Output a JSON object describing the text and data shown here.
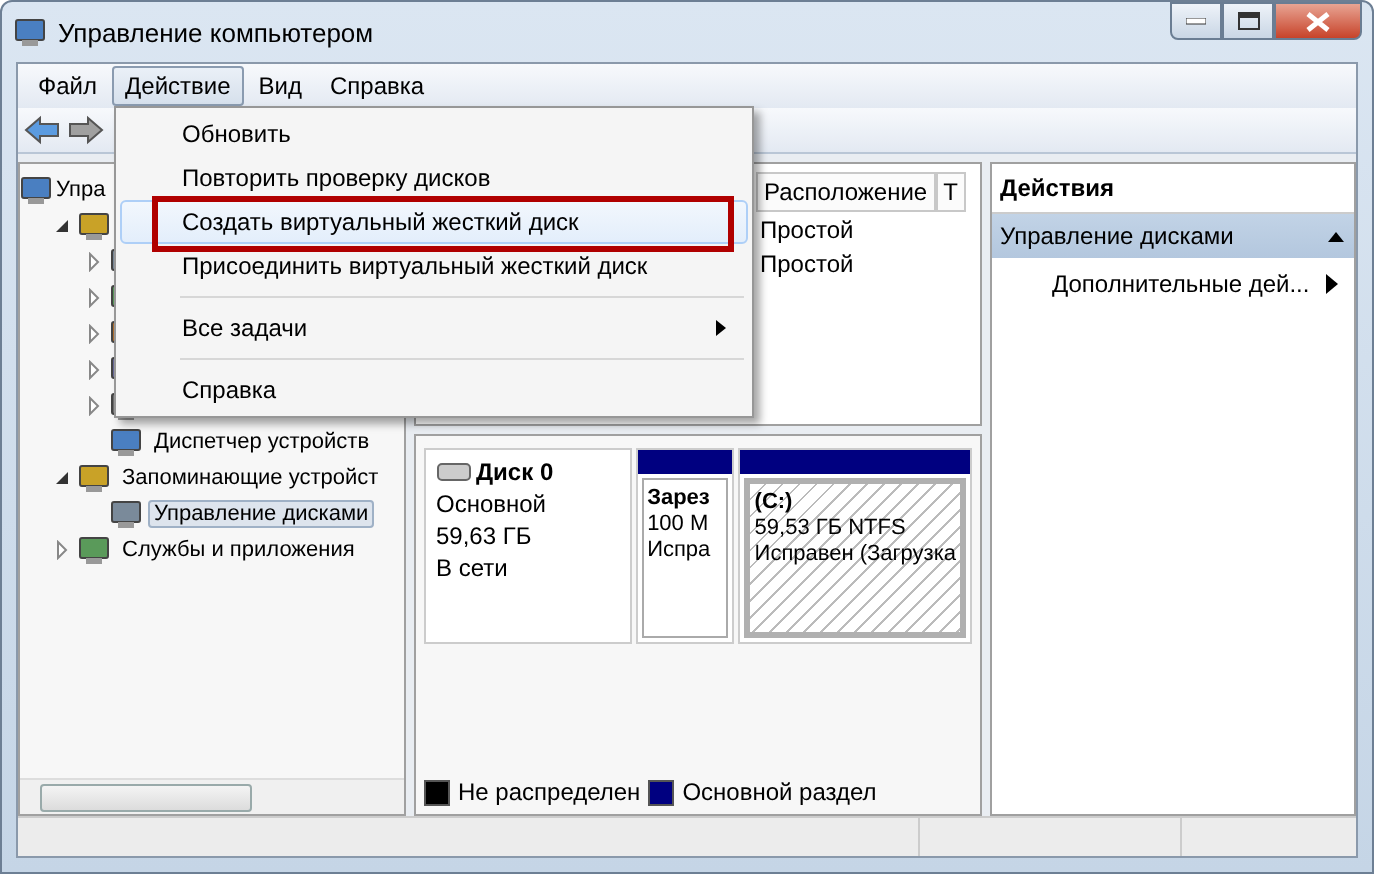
{
  "window": {
    "title": "Управление компьютером"
  },
  "menu_bar": [
    {
      "label": "Файл",
      "selected": false
    },
    {
      "label": "Действие",
      "selected": true
    },
    {
      "label": "Вид",
      "selected": false
    },
    {
      "label": "Справка",
      "selected": false
    }
  ],
  "dropdown": {
    "items": [
      {
        "kind": "item",
        "label": "Обновить",
        "highlighted": false
      },
      {
        "kind": "item",
        "label": "Повторить проверку дисков",
        "highlighted": false
      },
      {
        "kind": "item",
        "label": "Создать виртуальный жесткий диск",
        "highlighted": true
      },
      {
        "kind": "item",
        "label": "Присоединить виртуальный жесткий диск",
        "highlighted": false
      },
      {
        "kind": "separator"
      },
      {
        "kind": "submenu",
        "label": "Все задачи",
        "highlighted": false
      },
      {
        "kind": "separator"
      },
      {
        "kind": "item",
        "label": "Справка",
        "highlighted": false
      }
    ]
  },
  "tree": [
    {
      "label": "Упра",
      "selected": false,
      "children": [
        {
          "expanded": true,
          "selected": false,
          "children": [
            {
              "expanded": false,
              "selected": false
            },
            {
              "expanded": false,
              "selected": false
            },
            {
              "expanded": false,
              "selected": false
            },
            {
              "expanded": false,
              "selected": false
            },
            {
              "expanded": false,
              "selected": false
            },
            {
              "label": "Диспетчер устройств",
              "selected": false
            }
          ]
        },
        {
          "label": "Запоминающие устройст",
          "expanded": true,
          "selected": false,
          "children": [
            {
              "label": "Управление дисками",
              "selected": true
            }
          ]
        },
        {
          "label": "Службы и приложения",
          "expanded": false,
          "selected": false
        }
      ]
    }
  ],
  "volume_list": {
    "columns": [
      "Расположение",
      "Т"
    ],
    "rows": [
      [
        "Простой"
      ],
      [
        "Простой"
      ]
    ]
  },
  "disk": {
    "name": "Диск 0",
    "type": "Основной",
    "size": "59,63 ГБ",
    "status": "В сети",
    "partitions": [
      {
        "lines": [
          "Зарез",
          "100 М",
          "Испра"
        ],
        "color": "#000080",
        "selected": false
      },
      {
        "lines": [
          "(C:)",
          "59,53 ГБ NTFS",
          "Исправен (Загрузка"
        ],
        "color": "#000080",
        "selected": true
      }
    ]
  },
  "legend": [
    {
      "label": "Не распределен",
      "color": "#000000"
    },
    {
      "label": "Основной раздел",
      "color": "#000080"
    }
  ],
  "actions": {
    "title": "Действия",
    "sections": [
      {
        "label": "Управление дисками",
        "expanded": true,
        "items": [
          {
            "kind": "submenu",
            "label": "Дополнительные дей..."
          }
        ]
      }
    ]
  }
}
